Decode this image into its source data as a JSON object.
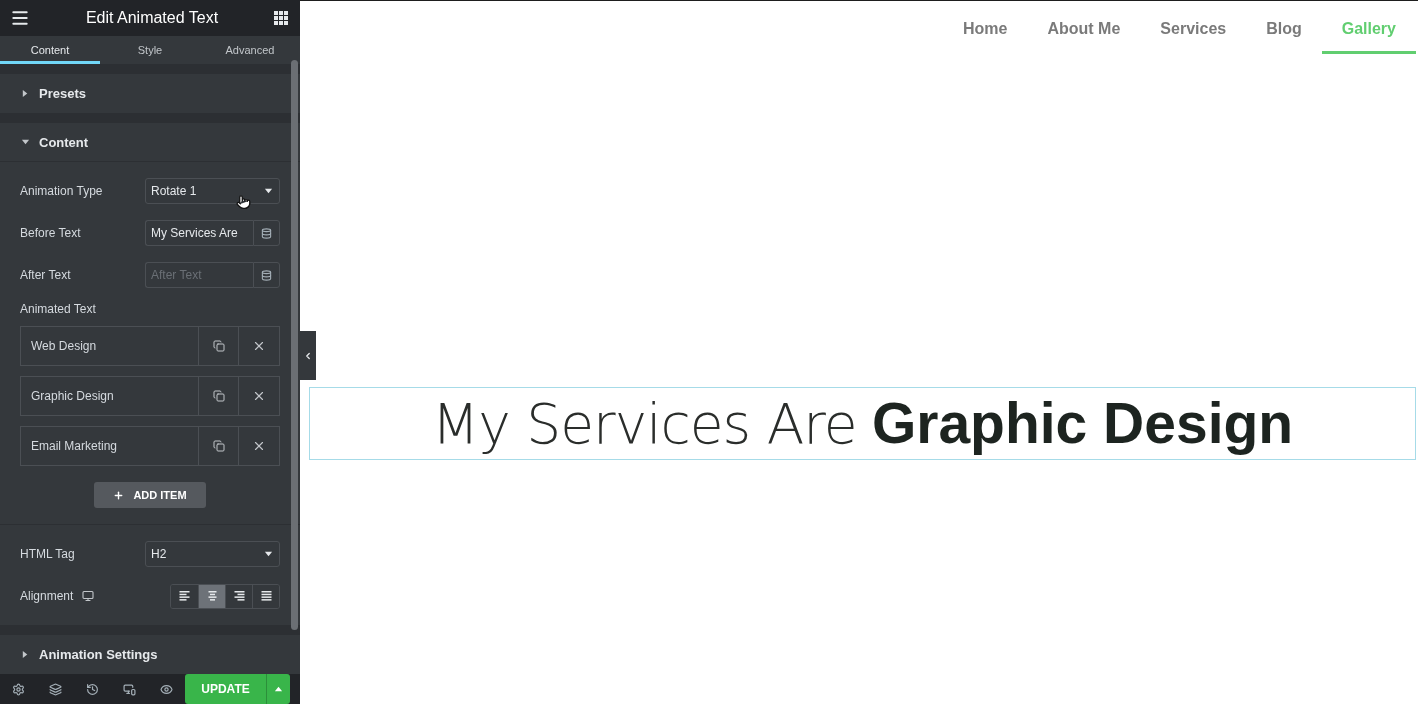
{
  "panel": {
    "title": "Edit Animated Text",
    "tabs": [
      {
        "label": "Content",
        "selected": true
      },
      {
        "label": "Style",
        "selected": false
      },
      {
        "label": "Advanced",
        "selected": false
      }
    ],
    "sections": [
      {
        "title": "Presets",
        "expanded": false
      },
      {
        "title": "Content",
        "expanded": true,
        "fields": [
          {
            "kind": "select",
            "label": "Animation Type",
            "value": "Rotate 1"
          },
          {
            "kind": "text",
            "label": "Before Text",
            "value": "My Services Are"
          },
          {
            "kind": "text",
            "label": "After Text",
            "placeholder": "After Text"
          },
          {
            "kind": "repeater",
            "label": "Animated Text",
            "items": [
              "Web Design",
              "Graphic Design",
              "Email Marketing"
            ],
            "add_label": "ADD ITEM"
          },
          {
            "kind": "divider"
          },
          {
            "kind": "select",
            "label": "HTML Tag",
            "value": "H2"
          },
          {
            "kind": "alignment",
            "label": "Alignment",
            "options": [
              {
                "kind": "left",
                "selected": false
              },
              {
                "kind": "center",
                "selected": true
              },
              {
                "kind": "right",
                "selected": false
              },
              {
                "kind": "justify",
                "selected": false
              }
            ]
          }
        ]
      },
      {
        "title": "Animation Settings",
        "expanded": false
      }
    ],
    "footer": {
      "tools": [
        {
          "kind": "settings"
        },
        {
          "kind": "layers"
        },
        {
          "kind": "history"
        },
        {
          "kind": "responsive"
        },
        {
          "kind": "preview"
        }
      ],
      "update_label": "UPDATE"
    }
  },
  "nav": [
    {
      "label": "Home",
      "selected": false
    },
    {
      "label": "About Me",
      "selected": false
    },
    {
      "label": "Services",
      "selected": false
    },
    {
      "label": "Blog",
      "selected": false
    },
    {
      "label": "Gallery",
      "selected": true
    }
  ],
  "headline": {
    "before_text": "My Services Are",
    "animated_text": "Graphic Design",
    "selected": true
  }
}
